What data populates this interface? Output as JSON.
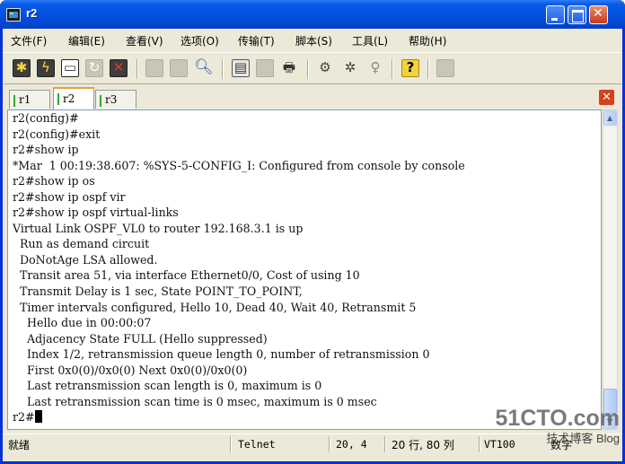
{
  "window": {
    "title": "r2"
  },
  "menu": [
    "文件(F)",
    "编辑(E)",
    "查看(V)",
    "选项(O)",
    "传输(T)",
    "脚本(S)",
    "工具(L)",
    "帮助(H)"
  ],
  "toolbar": {
    "icons": [
      "connect-icon",
      "quick-connect-icon",
      "connect-tab-icon",
      "reconnect-icon",
      "disconnect-icon",
      "copy-icon",
      "paste-icon",
      "find-icon",
      "print-setup-icon",
      "print-icon",
      "print-screen-icon",
      "session-options-icon",
      "global-options-icon",
      "keymap-icon",
      "help-icon",
      "sftp-icon"
    ]
  },
  "tabs": [
    {
      "label": "r1",
      "active": false
    },
    {
      "label": "r2",
      "active": true
    },
    {
      "label": "r3",
      "active": false
    }
  ],
  "terminal": {
    "lines": [
      "r2(config)#",
      "r2(config)#exit",
      "r2#show ip",
      "*Mar  1 00:19:38.607: %SYS-5-CONFIG_I: Configured from console by console",
      "r2#show ip os",
      "r2#show ip ospf vir",
      "r2#show ip ospf virtual-links",
      "Virtual Link OSPF_VL0 to router 192.168.3.1 is up",
      "  Run as demand circuit",
      "  DoNotAge LSA allowed.",
      "  Transit area 51, via interface Ethernet0/0, Cost of using 10",
      "  Transmit Delay is 1 sec, State POINT_TO_POINT,",
      "  Timer intervals configured, Hello 10, Dead 40, Wait 40, Retransmit 5",
      "    Hello due in 00:00:07",
      "    Adjacency State FULL (Hello suppressed)",
      "    Index 1/2, retransmission queue length 0, number of retransmission 0",
      "    First 0x0(0)/0x0(0) Next 0x0(0)/0x0(0)",
      "    Last retransmission scan length is 0, maximum is 0",
      "    Last retransmission scan time is 0 msec, maximum is 0 msec"
    ],
    "prompt": "r2#"
  },
  "status": {
    "ready": "就绪",
    "protocol": "Telnet",
    "position": "20,   4",
    "size": "20 行, 80 列",
    "emulation": "VT100",
    "caps": "数字"
  },
  "watermark": {
    "logo": "51CTO.com",
    "sub": "技术博客 Blog"
  }
}
